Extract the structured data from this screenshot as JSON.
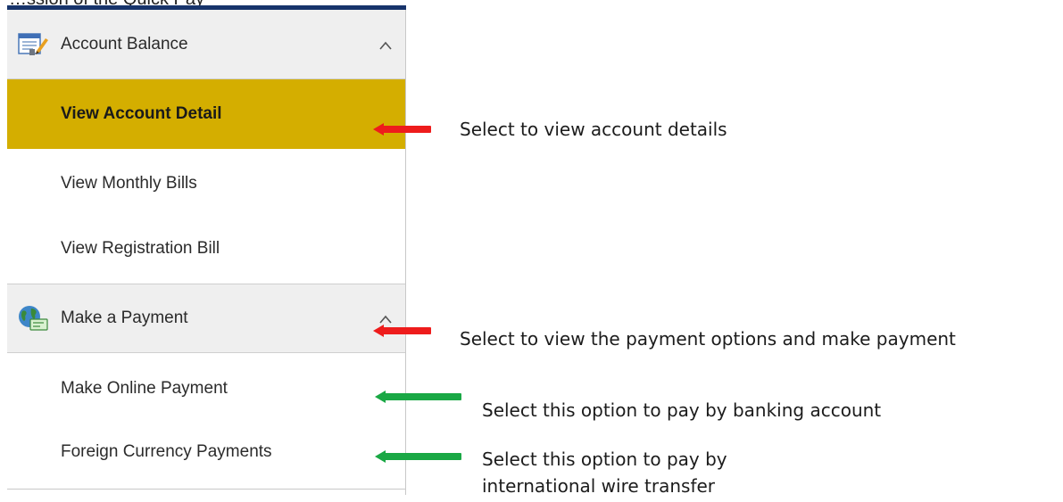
{
  "top_partial_text": "…ssion of the Quick Pay",
  "menu": {
    "sections": [
      {
        "label": "Account Balance",
        "icon": "account-form-icon",
        "items": [
          "View Account Detail",
          "View Monthly Bills",
          "View Registration Bill"
        ],
        "active_item": "View Account Detail"
      },
      {
        "label": "Make a Payment",
        "icon": "globe-payment-icon",
        "items": [
          "Make Online Payment",
          "Foreign Currency Payments"
        ]
      }
    ]
  },
  "annotations": [
    {
      "text": "Select to view account details",
      "arrow_color": "#ee1c1c"
    },
    {
      "text": "Select to view the payment options and make payment",
      "arrow_color": "#ee1c1c"
    },
    {
      "text": "Select this option to pay by banking account",
      "arrow_color": "#1aa845"
    },
    {
      "text": "Select this option to pay by international wire transfer",
      "arrow_color": "#1aa845"
    }
  ],
  "colors": {
    "active_item_bg": "#d4ae00",
    "header_bg": "#efefef",
    "top_rule": "#17346b"
  }
}
